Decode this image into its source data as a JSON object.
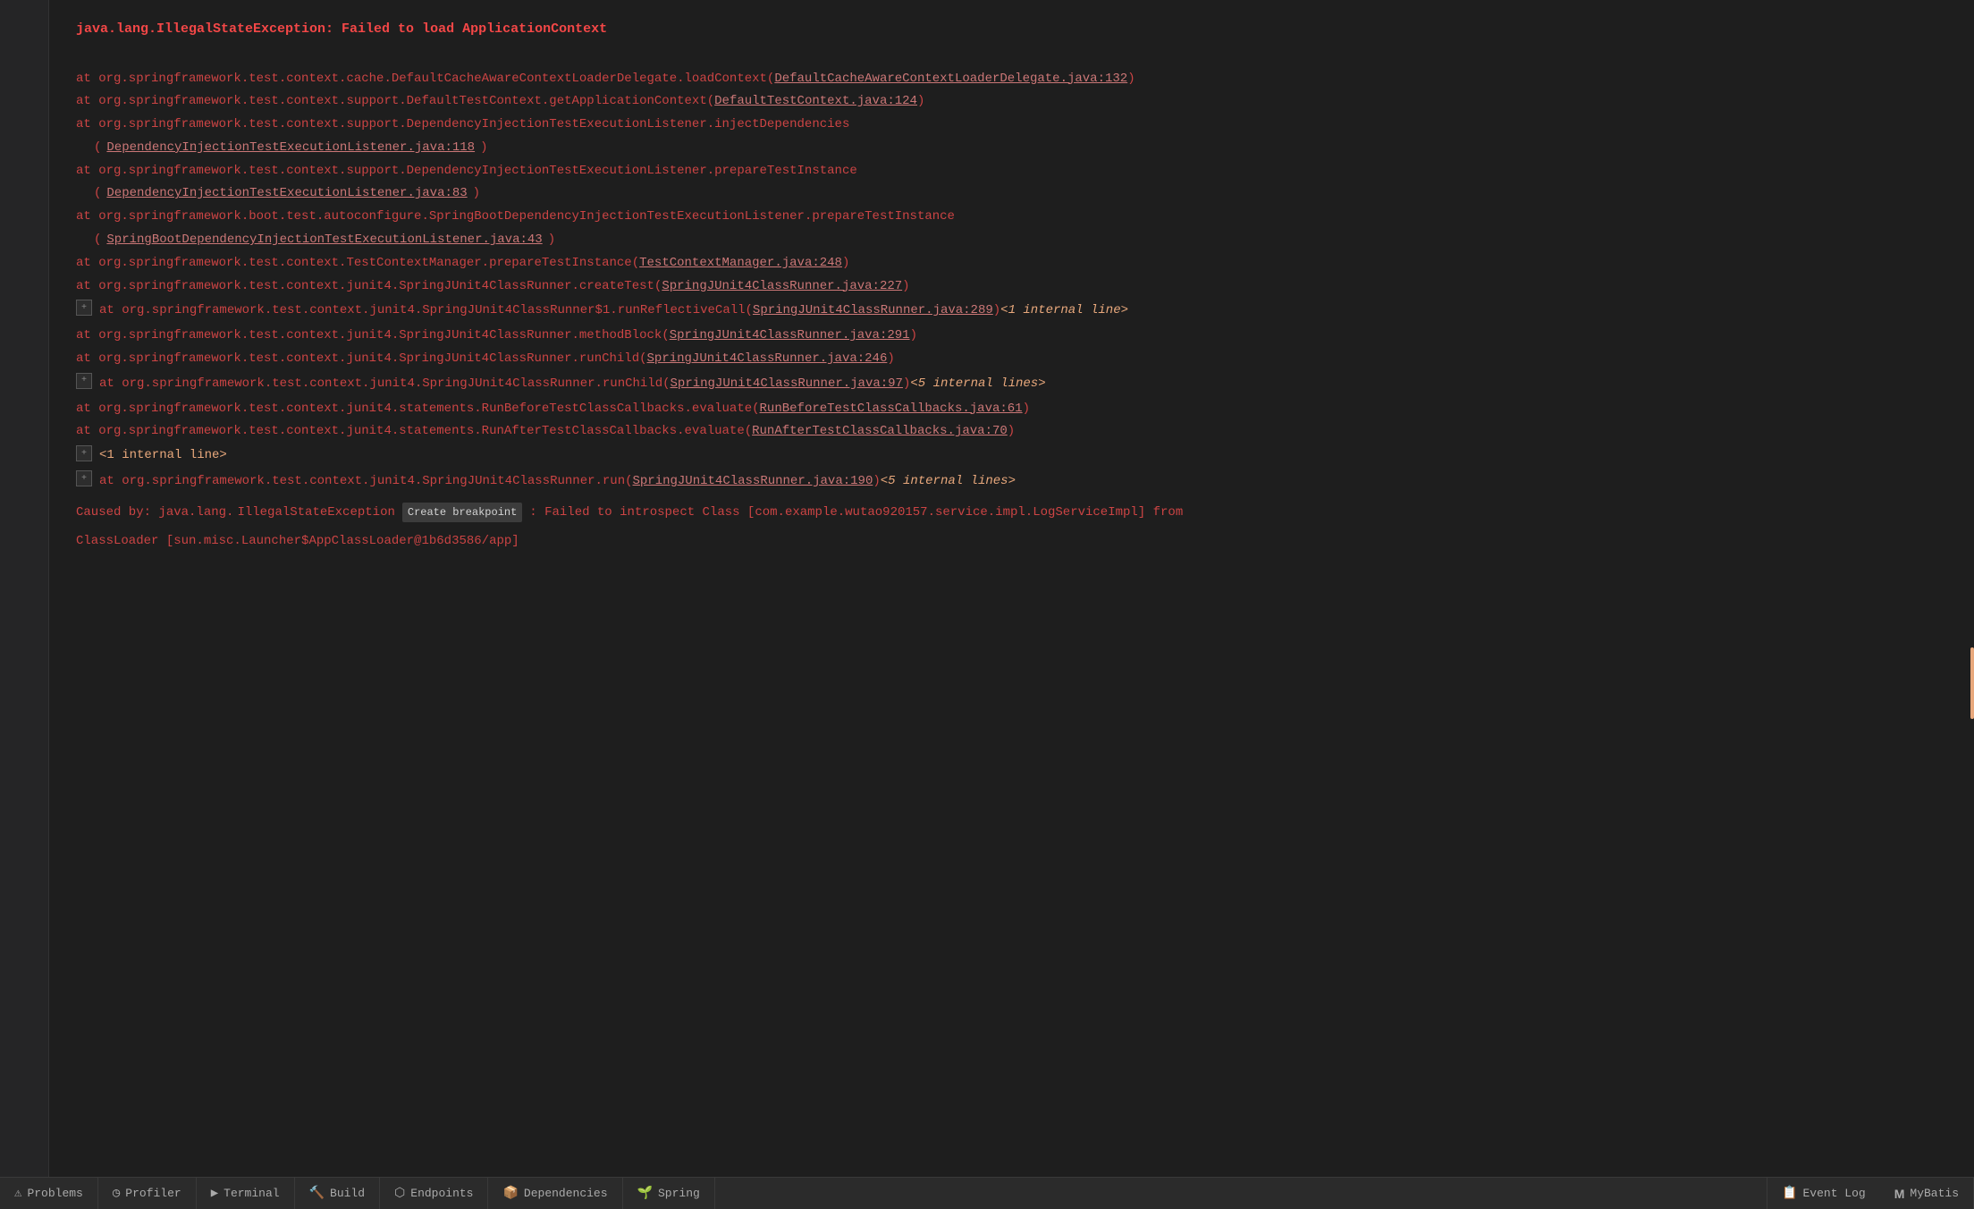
{
  "error": {
    "title": "java.lang.IllegalStateException: Failed to load ApplicationContext"
  },
  "stackLines": [
    {
      "id": "line1",
      "hasExpand": false,
      "indent": true,
      "text": "at org.springframework.test.context.cache.DefaultCacheAwareContextLoaderDelegate.loadContext(",
      "link": "DefaultCacheAwareContextLoaderDelegate.java:132",
      "after": ")",
      "internal": null
    },
    {
      "id": "line2",
      "hasExpand": false,
      "indent": true,
      "text": "at org.springframework.test.context.support.DefaultTestContext.getApplicationContext(",
      "link": "DefaultTestContext.java:124",
      "after": ")",
      "internal": null
    },
    {
      "id": "line3",
      "hasExpand": false,
      "indent": true,
      "multiline": true,
      "text1": "at org.springframework.test.context.support.DependencyInjectionTestExecutionListener.injectDependencies",
      "text2": "(",
      "link": "DependencyInjectionTestExecutionListener.java:118",
      "after": ")",
      "internal": null
    },
    {
      "id": "line4",
      "hasExpand": false,
      "indent": true,
      "multiline": true,
      "text1": "at org.springframework.test.context.support.DependencyInjectionTestExecutionListener.prepareTestInstance",
      "text2": "(",
      "link": "DependencyInjectionTestExecutionListener.java:83",
      "after": ")",
      "internal": null
    },
    {
      "id": "line5",
      "hasExpand": false,
      "indent": true,
      "multiline": true,
      "text1": "at org.springframework.boot.test.autoconfigure.SpringBootDependencyInjectionTestExecutionListener.prepareTestInstance",
      "text2": "(",
      "link": "SpringBootDependencyInjectionTestExecutionListener.java:43",
      "after": ")",
      "internal": null
    },
    {
      "id": "line6",
      "hasExpand": false,
      "indent": true,
      "text": "at org.springframework.test.context.TestContextManager.prepareTestInstance(",
      "link": "TestContextManager.java:248",
      "after": ")",
      "internal": null
    },
    {
      "id": "line7",
      "hasExpand": false,
      "indent": true,
      "text": "at org.springframework.test.context.junit4.SpringJUnit4ClassRunner.createTest(",
      "link": "SpringJUnit4ClassRunner.java:227",
      "after": ")",
      "internal": null
    },
    {
      "id": "line8",
      "hasExpand": true,
      "indent": true,
      "text": "at org.springframework.test.context.junit4.SpringJUnit4ClassRunner$1.runReflectiveCall(",
      "link": "SpringJUnit4ClassRunner.java:289",
      "after": ")",
      "internal": "<1 internal line>"
    },
    {
      "id": "line9",
      "hasExpand": false,
      "indent": true,
      "text": "at org.springframework.test.context.junit4.SpringJUnit4ClassRunner.methodBlock(",
      "link": "SpringJUnit4ClassRunner.java:291",
      "after": ")",
      "internal": null
    },
    {
      "id": "line10",
      "hasExpand": false,
      "indent": true,
      "text": "at org.springframework.test.context.junit4.SpringJUnit4ClassRunner.runChild(",
      "link": "SpringJUnit4ClassRunner.java:246",
      "after": ")",
      "internal": null
    },
    {
      "id": "line11",
      "hasExpand": true,
      "indent": true,
      "text": "at org.springframework.test.context.junit4.SpringJUnit4ClassRunner.runChild(",
      "link": "SpringJUnit4ClassRunner.java:97",
      "after": ")",
      "internal": "<5 internal lines>"
    },
    {
      "id": "line12",
      "hasExpand": false,
      "indent": true,
      "text": "at org.springframework.test.context.junit4.statements.RunBeforeTestClassCallbacks.evaluate(",
      "link": "RunBeforeTestClassCallbacks.java:61",
      "after": ")",
      "internal": null
    },
    {
      "id": "line13",
      "hasExpand": false,
      "indent": true,
      "text": "at org.springframework.test.context.junit4.statements.RunAfterTestClassCallbacks.evaluate(",
      "link": "RunAfterTestClassCallbacks.java:70",
      "after": ")",
      "internal": null
    }
  ],
  "internalLine1": {
    "expand": true,
    "text": "<1 internal line>"
  },
  "line14": {
    "hasExpand": true,
    "indent": true,
    "text": "at org.springframework.test.context.junit4.SpringJUnit4ClassRunner.run(",
    "link": "SpringJUnit4ClassRunner.java:190",
    "after": ")",
    "internal": "<5 internal lines>"
  },
  "causedBy": {
    "prefix": "Caused by: java.lang.",
    "link": "IllegalStateException",
    "createBp": "Create breakpoint",
    "rest": ": Failed to introspect Class [com.example.wutao920157.service.impl.LogServiceImpl] from",
    "nextLine": "ClassLoader [sun.misc.Launcher$AppClassLoader@1b6d3586/app]"
  },
  "bottomBar": {
    "tabs": [
      {
        "id": "problems",
        "icon": "⚠",
        "label": "Problems"
      },
      {
        "id": "profiler",
        "icon": "◷",
        "label": "Profiler"
      },
      {
        "id": "terminal",
        "icon": "▶",
        "label": "Terminal"
      },
      {
        "id": "build",
        "icon": "🔨",
        "label": "Build"
      },
      {
        "id": "endpoints",
        "icon": "⬡",
        "label": "Endpoints"
      },
      {
        "id": "dependencies",
        "icon": "📦",
        "label": "Dependencies"
      },
      {
        "id": "spring",
        "icon": "🌱",
        "label": "Spring"
      }
    ],
    "rightTabs": [
      {
        "id": "event-log",
        "icon": "📋",
        "label": "Event Log"
      },
      {
        "id": "mybatis",
        "icon": "M",
        "label": "MyBatis"
      }
    ]
  },
  "scrollbar": {
    "color": "#e8a87c"
  },
  "from_text": "from",
  "to_text": "to"
}
